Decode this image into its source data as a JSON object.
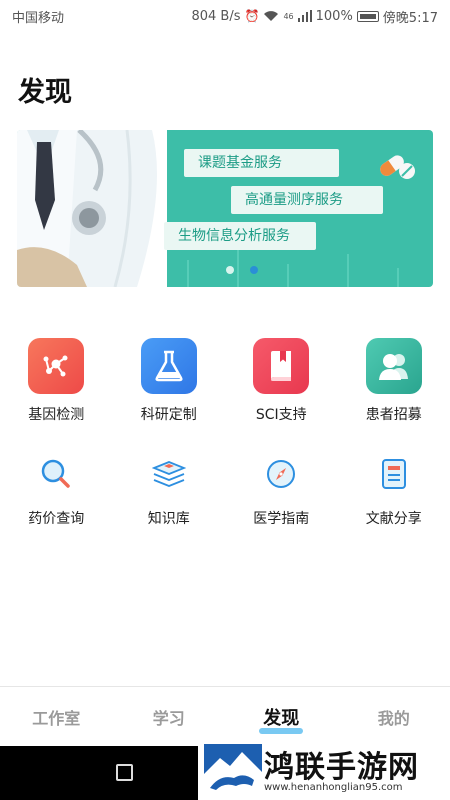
{
  "status_bar": {
    "carrier": "中国移动",
    "speed": "804 B/s",
    "signal": "46",
    "battery": "100%",
    "time": "傍晚5:17"
  },
  "page": {
    "title": "发现"
  },
  "banner": {
    "tags": [
      "课题基金服务",
      "高通量测序服务",
      "生物信息分析服务"
    ],
    "slide_count": 2,
    "active_slide": 2,
    "colors": {
      "background": "#3dbea8",
      "tag_bg": "#eaf7f3",
      "tag_text": "#1c9c86",
      "dot_active": "#2a8fd6"
    }
  },
  "features": [
    {
      "label": "基因检测",
      "icon": "molecule-icon",
      "color": "#f2604a"
    },
    {
      "label": "科研定制",
      "icon": "flask-icon",
      "color": "#3a86f0"
    },
    {
      "label": "SCI支持",
      "icon": "book-icon",
      "color": "#f0455c"
    },
    {
      "label": "患者招募",
      "icon": "users-icon",
      "color": "#35b59e"
    }
  ],
  "tools": [
    {
      "label": "药价查询",
      "icon": "magnifier-icon"
    },
    {
      "label": "知识库",
      "icon": "stacked-books-icon"
    },
    {
      "label": "医学指南",
      "icon": "compass-icon"
    },
    {
      "label": "文献分享",
      "icon": "document-icon"
    }
  ],
  "bottom_nav": {
    "items": [
      "工作室",
      "学习",
      "发现",
      "我的"
    ],
    "active": "发现"
  },
  "watermark": {
    "title": "鸿联手游网",
    "url": "www.henanhonglian95.com"
  }
}
